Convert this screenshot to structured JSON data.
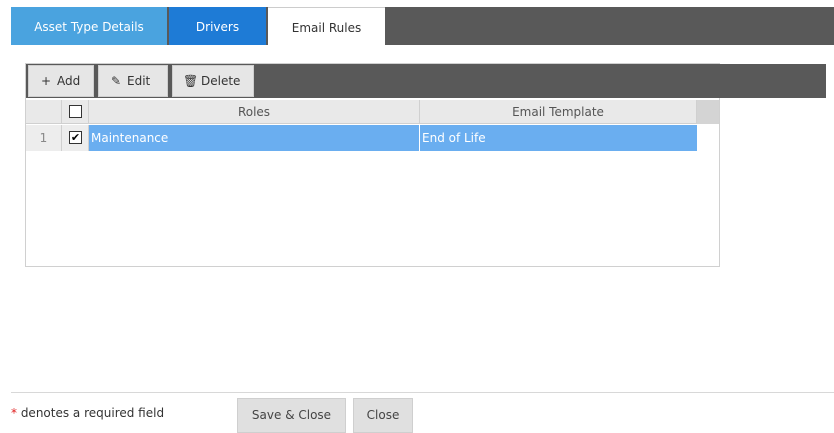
{
  "tabs": [
    {
      "label": "Asset Type Details"
    },
    {
      "label": "Drivers"
    },
    {
      "label": "Email Rules"
    }
  ],
  "toolbar": {
    "add_label": "Add",
    "edit_label": "Edit",
    "delete_label": "Delete",
    "add_icon": "+",
    "edit_icon": "✎",
    "delete_icon": "🗑"
  },
  "grid": {
    "columns": [
      "Roles",
      "Email Template"
    ],
    "rows": [
      {
        "num": "1",
        "checked": true,
        "role": "Maintenance",
        "template": "End of Life"
      }
    ],
    "header_checked": false
  },
  "footer": {
    "required_star": "*",
    "required_text": " denotes a required field",
    "save_close_label": "Save & Close",
    "close_label": "Close"
  },
  "colors": {
    "tab_asset": "#4aa3df",
    "tab_drivers": "#1e7bd6",
    "selected_row": "#6aaef0",
    "toolbar_bg": "#595959"
  }
}
